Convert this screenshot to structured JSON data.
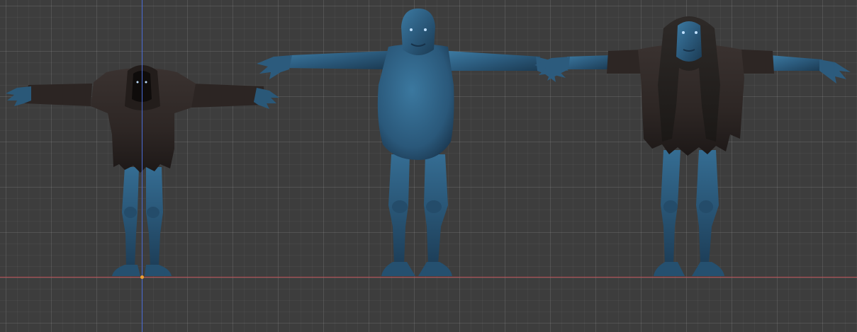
{
  "viewport": {
    "view": "front-orthographic",
    "grid": true
  },
  "colors": {
    "background": "#3d3d3d",
    "grid_major": "#4a4a4a",
    "grid_minor": "#444444",
    "x_axis": "#b44a4f",
    "z_axis": "#4a6bd6",
    "origin": "#f0a030",
    "skin": "#2c5a7c",
    "skin_dark": "#1c3b55",
    "skin_light": "#3e7aa3",
    "cloth": "#302927",
    "cloth_dark": "#1e1917",
    "eye": "#bfe0ff"
  },
  "objects": [
    {
      "name": "figure-hooded",
      "icon": "t-pose-hooded-figure"
    },
    {
      "name": "figure-bare",
      "icon": "t-pose-bare-figure"
    },
    {
      "name": "figure-hair-cloak",
      "icon": "t-pose-long-hair-figure"
    }
  ]
}
